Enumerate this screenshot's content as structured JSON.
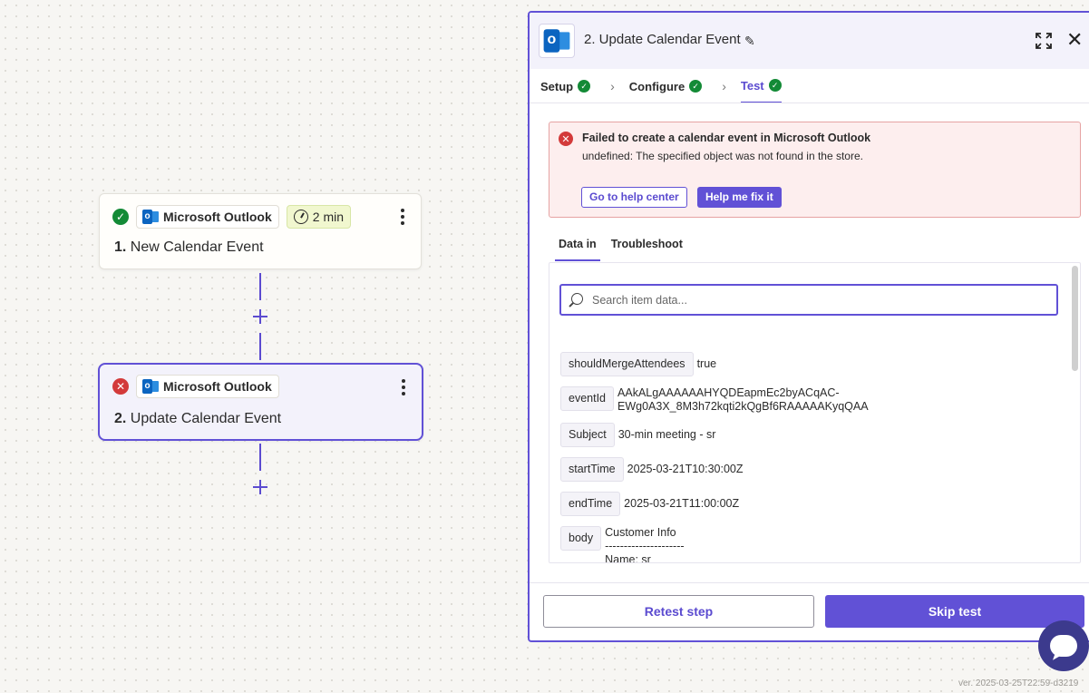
{
  "canvas": {
    "node1": {
      "app_name": "Microsoft Outlook",
      "duration": "2 min",
      "step_number": "1.",
      "title": "New Calendar Event"
    },
    "node2": {
      "app_name": "Microsoft Outlook",
      "step_number": "2.",
      "title": "Update Calendar Event"
    }
  },
  "panel": {
    "title": "2. Update Calendar Event",
    "steps": [
      "Setup",
      "Configure",
      "Test"
    ],
    "alert": {
      "title": "Failed to create a calendar event in Microsoft Outlook",
      "message": "undefined: The specified object was not found in the store.",
      "help_button": "Go to help center",
      "fix_button": "Help me fix it"
    },
    "tabs": [
      "Data in",
      "Troubleshoot"
    ],
    "search_placeholder": "Search item data...",
    "fields": [
      {
        "key": "shouldMergeAttendees",
        "value": "true"
      },
      {
        "key": "eventId",
        "value": "AAkALgAAAAAAHYQDEapmEc2byACqAC-\nEWg0A3X_8M3h72kqti2kQgBf6RAAAAAKyqQAA"
      },
      {
        "key": "Subject",
        "value": "30-min meeting - sr"
      },
      {
        "key": "startTime",
        "value": "2025-03-21T10:30:00Z"
      },
      {
        "key": "endTime",
        "value": "2025-03-21T11:00:00Z"
      },
      {
        "key": "body",
        "value": "Customer Info\n---------------------\nName: sr"
      }
    ],
    "retest_button": "Retest step",
    "skip_button": "Skip test"
  },
  "version": "ver. 2025-03-25T22:59-d3219",
  "colors": {
    "accent": "#6151d6",
    "success": "#138a36",
    "error": "#d33a3a",
    "alert_bg": "#fdeeee"
  }
}
